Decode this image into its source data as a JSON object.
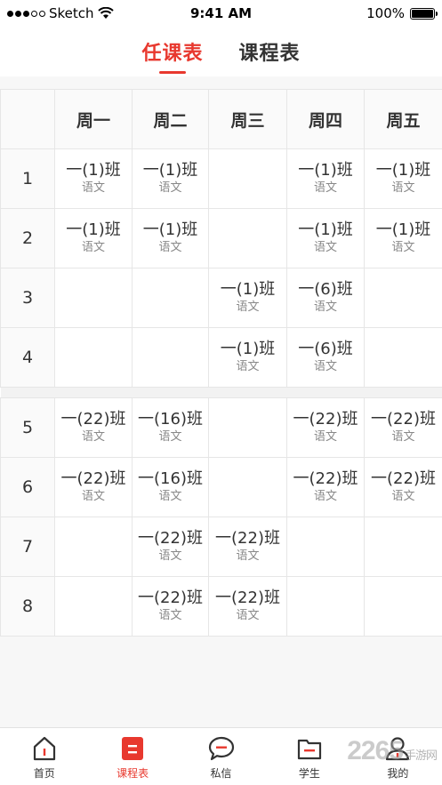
{
  "status_bar": {
    "carrier": "Sketch",
    "time": "9:41 AM",
    "battery": "100%"
  },
  "tabs": [
    {
      "label": "任课表",
      "active": true
    },
    {
      "label": "课程表",
      "active": false
    }
  ],
  "timetable": {
    "days": [
      "周一",
      "周二",
      "周三",
      "周四",
      "周五"
    ],
    "morning": [
      {
        "period": "1",
        "cells": [
          {
            "cls": "一(1)班",
            "subj": "语文"
          },
          {
            "cls": "一(1)班",
            "subj": "语文"
          },
          {},
          {
            "cls": "一(1)班",
            "subj": "语文"
          },
          {
            "cls": "一(1)班",
            "subj": "语文"
          }
        ]
      },
      {
        "period": "2",
        "cells": [
          {
            "cls": "一(1)班",
            "subj": "语文"
          },
          {
            "cls": "一(1)班",
            "subj": "语文"
          },
          {},
          {
            "cls": "一(1)班",
            "subj": "语文"
          },
          {
            "cls": "一(1)班",
            "subj": "语文"
          }
        ]
      },
      {
        "period": "3",
        "cells": [
          {},
          {},
          {
            "cls": "一(1)班",
            "subj": "语文"
          },
          {
            "cls": "一(6)班",
            "subj": "语文"
          },
          {}
        ]
      },
      {
        "period": "4",
        "cells": [
          {},
          {},
          {
            "cls": "一(1)班",
            "subj": "语文"
          },
          {
            "cls": "一(6)班",
            "subj": "语文"
          },
          {}
        ]
      }
    ],
    "afternoon": [
      {
        "period": "5",
        "cells": [
          {
            "cls": "一(22)班",
            "subj": "语文"
          },
          {
            "cls": "一(16)班",
            "subj": "语文"
          },
          {},
          {
            "cls": "一(22)班",
            "subj": "语文"
          },
          {
            "cls": "一(22)班",
            "subj": "语文"
          }
        ]
      },
      {
        "period": "6",
        "cells": [
          {
            "cls": "一(22)班",
            "subj": "语文"
          },
          {
            "cls": "一(16)班",
            "subj": "语文"
          },
          {},
          {
            "cls": "一(22)班",
            "subj": "语文"
          },
          {
            "cls": "一(22)班",
            "subj": "语文"
          }
        ]
      },
      {
        "period": "7",
        "cells": [
          {},
          {
            "cls": "一(22)班",
            "subj": "语文"
          },
          {
            "cls": "一(22)班",
            "subj": "语文"
          },
          {},
          {}
        ]
      },
      {
        "period": "8",
        "cells": [
          {},
          {
            "cls": "一(22)班",
            "subj": "语文"
          },
          {
            "cls": "一(22)班",
            "subj": "语文"
          },
          {},
          {}
        ]
      }
    ]
  },
  "bottom_nav": [
    {
      "label": "首页",
      "icon": "home-icon",
      "active": false
    },
    {
      "label": "课程表",
      "icon": "schedule-icon",
      "active": true
    },
    {
      "label": "私信",
      "icon": "message-icon",
      "active": false
    },
    {
      "label": "学生",
      "icon": "folder-icon",
      "active": false
    },
    {
      "label": "我的",
      "icon": "profile-icon",
      "active": false
    }
  ],
  "watermark": {
    "main": "2265",
    "sub": "手游网"
  },
  "colors": {
    "accent": "#e8382e",
    "text": "#333333",
    "muted": "#888888",
    "border": "#e6e6e6"
  }
}
